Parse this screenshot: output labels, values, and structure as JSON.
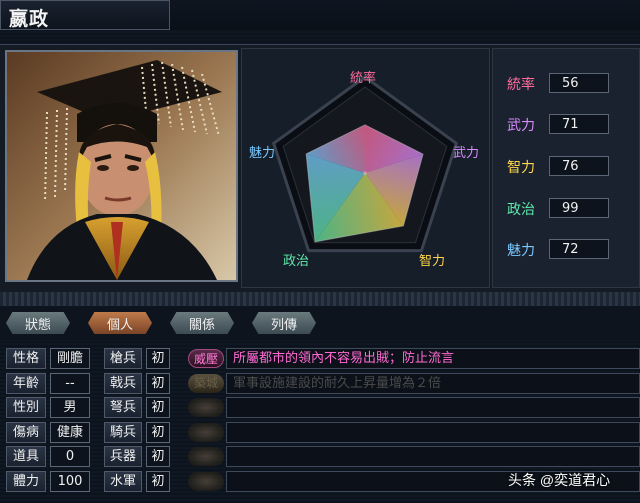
{
  "title": "嬴政",
  "radar": {
    "labels": [
      "統率",
      "武力",
      "智力",
      "政治",
      "魅力"
    ],
    "label_colors": [
      "#ff6c9c",
      "#d88cff",
      "#ffd64a",
      "#5fe8a8",
      "#7ac8ff"
    ]
  },
  "stats": [
    {
      "label": "統率",
      "value": "56",
      "color": "#ff6c9c"
    },
    {
      "label": "武力",
      "value": "71",
      "color": "#d88cff"
    },
    {
      "label": "智力",
      "value": "76",
      "color": "#ffd64a"
    },
    {
      "label": "政治",
      "value": "99",
      "color": "#5fe8a8"
    },
    {
      "label": "魅力",
      "value": "72",
      "color": "#7ac8ff"
    }
  ],
  "tabs": [
    "狀態",
    "個人",
    "關係",
    "列傳"
  ],
  "active_tab": "個人",
  "personal": [
    {
      "label": "性格",
      "value": "剛膽"
    },
    {
      "label": "年齡",
      "value": "--"
    },
    {
      "label": "性別",
      "value": "男"
    },
    {
      "label": "傷病",
      "value": "健康"
    },
    {
      "label": "道具",
      "value": "0"
    },
    {
      "label": "體力",
      "value": "100"
    }
  ],
  "aptitude": [
    {
      "label": "槍兵",
      "value": "初"
    },
    {
      "label": "戟兵",
      "value": "初"
    },
    {
      "label": "弩兵",
      "value": "初"
    },
    {
      "label": "騎兵",
      "value": "初"
    },
    {
      "label": "兵器",
      "value": "初"
    },
    {
      "label": "水軍",
      "value": "初"
    }
  ],
  "skills": [
    {
      "tag": "威壓",
      "desc": "所屬都市的領內不容易出賊；防止流言",
      "active": true
    },
    {
      "tag": "築城",
      "desc": "軍事設施建設的耐久上昇量增為２倍",
      "active": false
    },
    {
      "tag": "",
      "desc": "",
      "active": false
    },
    {
      "tag": "",
      "desc": "",
      "active": false
    },
    {
      "tag": "",
      "desc": "",
      "active": false
    },
    {
      "tag": "",
      "desc": "",
      "active": false
    }
  ],
  "watermark": "头条 @奕道君心"
}
